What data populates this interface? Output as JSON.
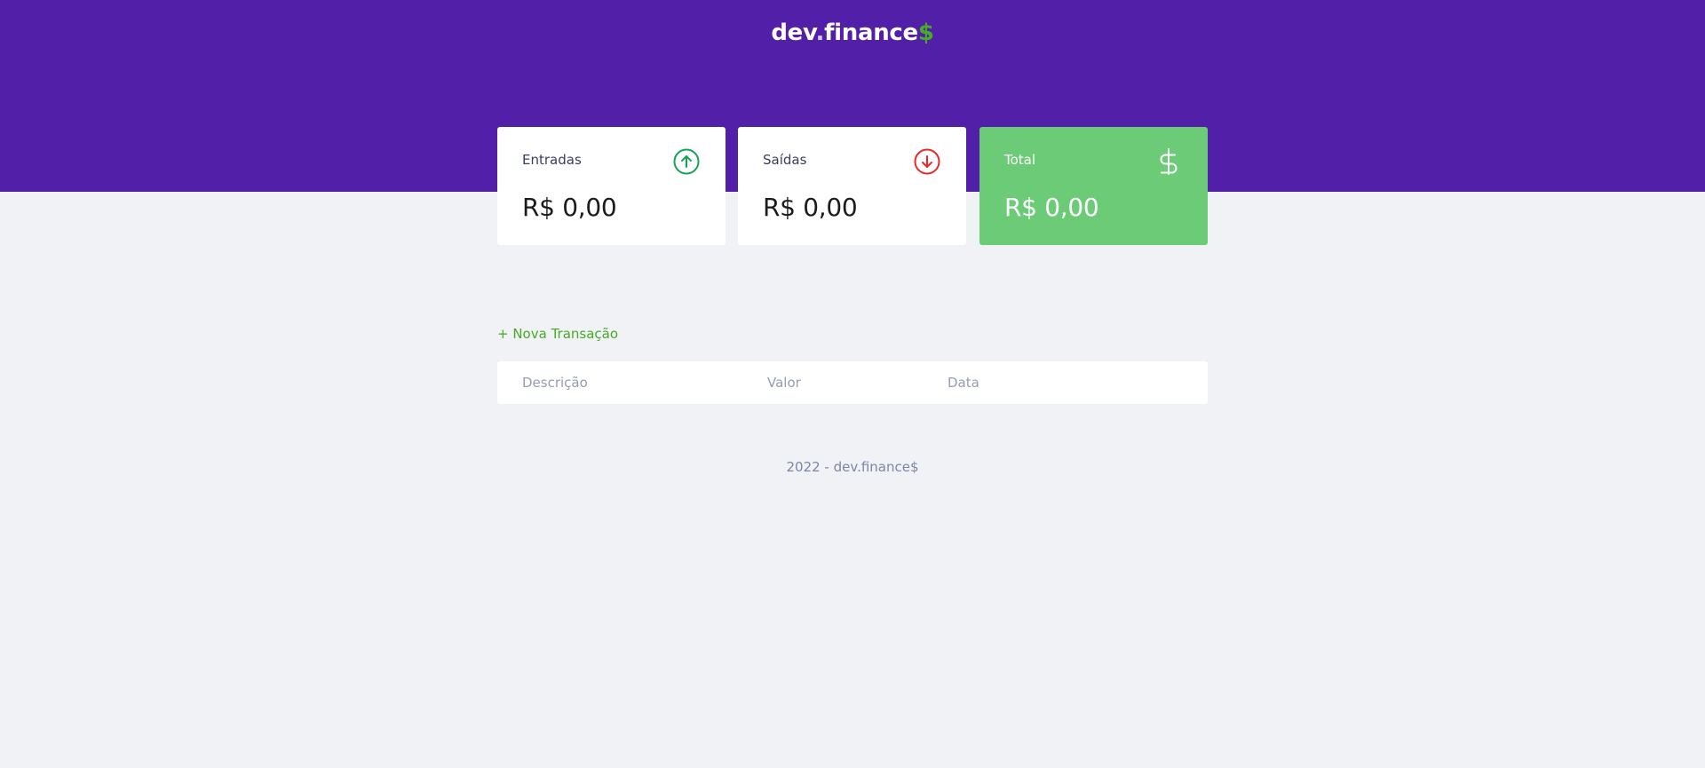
{
  "header": {
    "logo": {
      "part1": "dev",
      "dot": ".",
      "part2": "finance",
      "dollar": "$"
    }
  },
  "cards": {
    "income": {
      "title": "Entradas",
      "value": "R$ 0,00",
      "icon": "arrow-up-circle-icon"
    },
    "expense": {
      "title": "Saídas",
      "value": "R$ 0,00",
      "icon": "arrow-down-circle-icon"
    },
    "total": {
      "title": "Total",
      "value": "R$ 0,00",
      "icon": "dollar-sign-icon"
    }
  },
  "transactions": {
    "new_label": "+ Nova Transação",
    "columns": [
      "Descrição",
      "Valor",
      "Data"
    ]
  },
  "footer": {
    "text": "2022 - dev.finance$"
  },
  "colors": {
    "header_bg": "#521FA9",
    "page_bg": "#F0F2F5",
    "income_accent": "#12A454",
    "expense_accent": "#E92929",
    "total_bg": "#6CCB76",
    "link_green": "#49AA26"
  }
}
